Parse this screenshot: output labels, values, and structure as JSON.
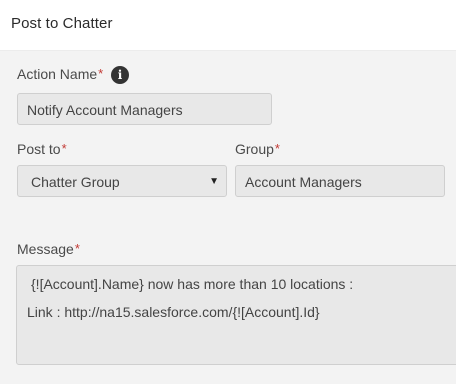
{
  "header": {
    "title": "Post to Chatter"
  },
  "form": {
    "action_name": {
      "label": "Action Name",
      "required_mark": "*",
      "value": "Notify Account Managers",
      "info_icon": "info-icon"
    },
    "post_to": {
      "label": "Post to",
      "required_mark": "*",
      "selected": "Chatter Group",
      "caret": "▼"
    },
    "group": {
      "label": "Group",
      "required_mark": "*",
      "value": "Account Managers"
    },
    "message": {
      "label": "Message",
      "required_mark": "*",
      "line1": "{![Account].Name} now has more than 10 locations :",
      "line2": "Link : http://na15.salesforce.com/{![Account].Id}"
    }
  },
  "colors": {
    "required": "#c23934",
    "field_bg": "#e8e8e8",
    "page_bg": "#f3f3f3"
  }
}
